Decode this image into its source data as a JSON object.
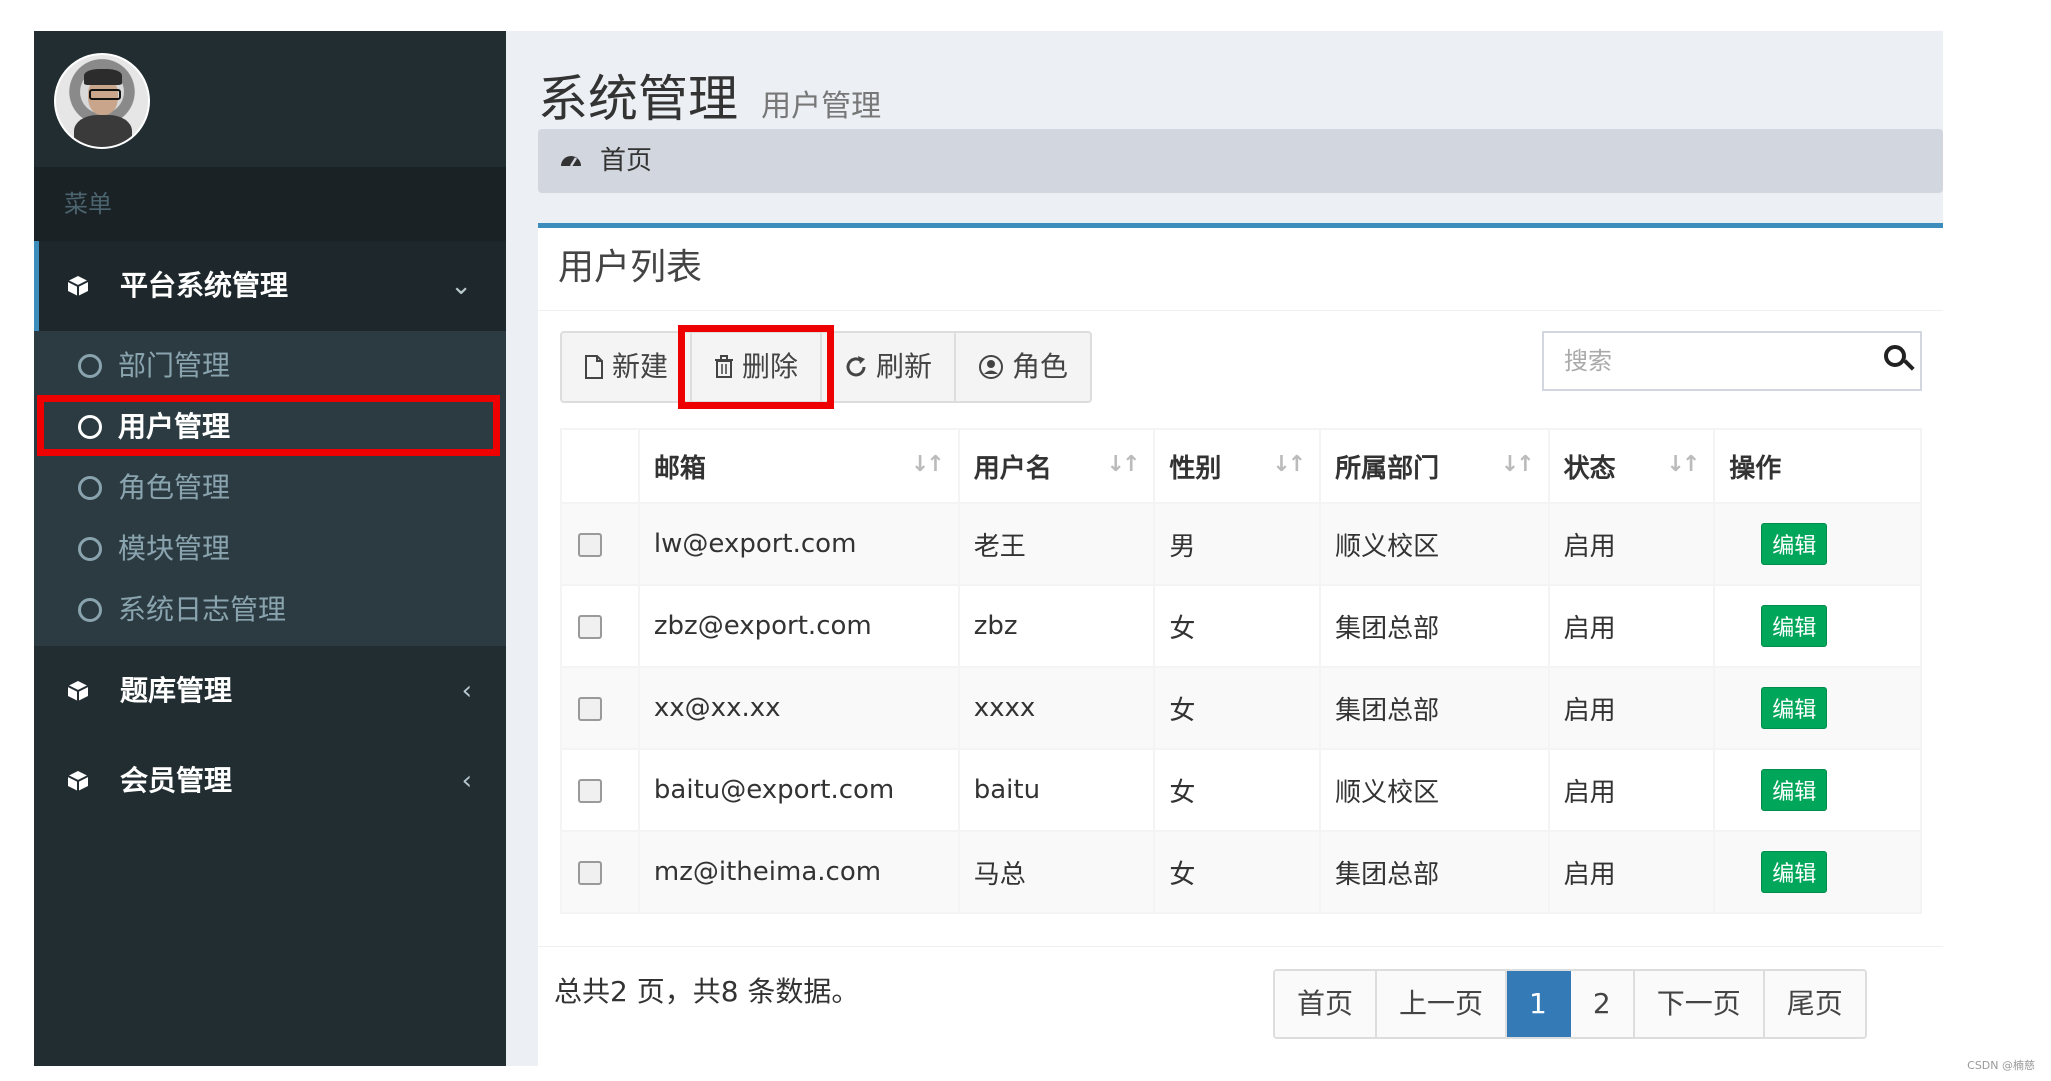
{
  "sidebar": {
    "menu_header": "菜单",
    "groups": [
      {
        "label": "平台系统管理",
        "chevron": "⌄",
        "icon": "cube-icon"
      },
      {
        "label": "题库管理",
        "chevron": "‹",
        "icon": "cube-icon"
      },
      {
        "label": "会员管理",
        "chevron": "‹",
        "icon": "cube-icon"
      }
    ],
    "sub_items": [
      {
        "label": "部门管理"
      },
      {
        "label": "用户管理"
      },
      {
        "label": "角色管理"
      },
      {
        "label": "模块管理"
      },
      {
        "label": "系统日志管理"
      }
    ]
  },
  "header": {
    "title": "系统管理",
    "subtitle": "用户管理",
    "breadcrumb": "首页",
    "breadcrumb_icon": "dashboard-icon"
  },
  "box": {
    "title": "用户列表",
    "toolbar": {
      "new_label": "新建",
      "delete_label": "删除",
      "refresh_label": "刷新",
      "role_label": "角色"
    },
    "search": {
      "placeholder": "搜索"
    },
    "columns": [
      "邮箱",
      "用户名",
      "性别",
      "所属部门",
      "状态",
      "操作"
    ],
    "rows": [
      {
        "email": "lw@export.com",
        "username": "老王",
        "gender": "男",
        "dept": "顺义校区",
        "status": "启用",
        "action": "编辑"
      },
      {
        "email": "zbz@export.com",
        "username": "zbz",
        "gender": "女",
        "dept": "集团总部",
        "status": "启用",
        "action": "编辑"
      },
      {
        "email": "xx@xx.xx",
        "username": "xxxx",
        "gender": "女",
        "dept": "集团总部",
        "status": "启用",
        "action": "编辑"
      },
      {
        "email": "baitu@export.com",
        "username": "baitu",
        "gender": "女",
        "dept": "顺义校区",
        "status": "启用",
        "action": "编辑"
      },
      {
        "email": "mz@itheima.com",
        "username": "马总",
        "gender": "女",
        "dept": "集团总部",
        "status": "启用",
        "action": "编辑"
      }
    ],
    "summary": "总共2 页，共8 条数据。",
    "pagination": {
      "first": "首页",
      "prev": "上一页",
      "pages": [
        "1",
        "2"
      ],
      "next": "下一页",
      "last": "尾页"
    }
  },
  "watermark": "CSDN @楠慈",
  "colors": {
    "sidebar_bg": "#222d32",
    "accent": "#3c8dbc",
    "highlight": "#ee0000",
    "edit_button": "#00a65a"
  }
}
